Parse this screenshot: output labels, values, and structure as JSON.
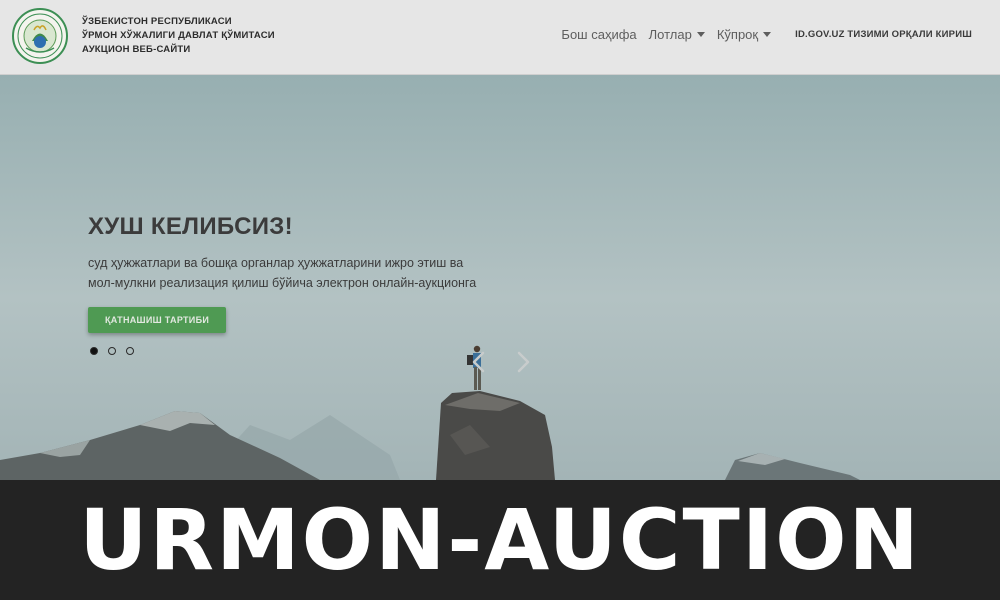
{
  "header": {
    "org_lines": [
      "ЎЗБЕКИСТОН РЕСПУБЛИКАСИ",
      "ЎРМОН ХЎЖАЛИГИ ДАВЛАТ ҚЎМИТАСИ",
      "АУКЦИОН ВЕБ-САЙТИ"
    ],
    "nav": {
      "home": "Бош саҳифа",
      "lots": "Лотлар",
      "more": "Кўпроқ",
      "login": "ID.GOV.UZ ТИЗИМИ ОРҚАЛИ КИРИШ"
    }
  },
  "hero": {
    "title": "ХУШ КЕЛИБСИЗ!",
    "text": "суд ҳужжатлари ва бошқа органлар ҳужжатларини ижро этиш ва мол-мулкни реализация қилиш бўйича электрон онлайн-аукционга",
    "cta": "ҚАТНАШИШ ТАРТИБИ",
    "slides_count": 3,
    "active_slide": 1
  },
  "banner": {
    "text": "URMON-AUCTION"
  },
  "colors": {
    "header_bg": "#e6e6e6",
    "cta_green": "#4f9a53",
    "banner_bg": "#232323"
  },
  "icons": {
    "logo": "emblem-logo",
    "prev": "chevron-left-icon",
    "next": "chevron-right-icon",
    "dropdown": "caret-down-icon"
  }
}
